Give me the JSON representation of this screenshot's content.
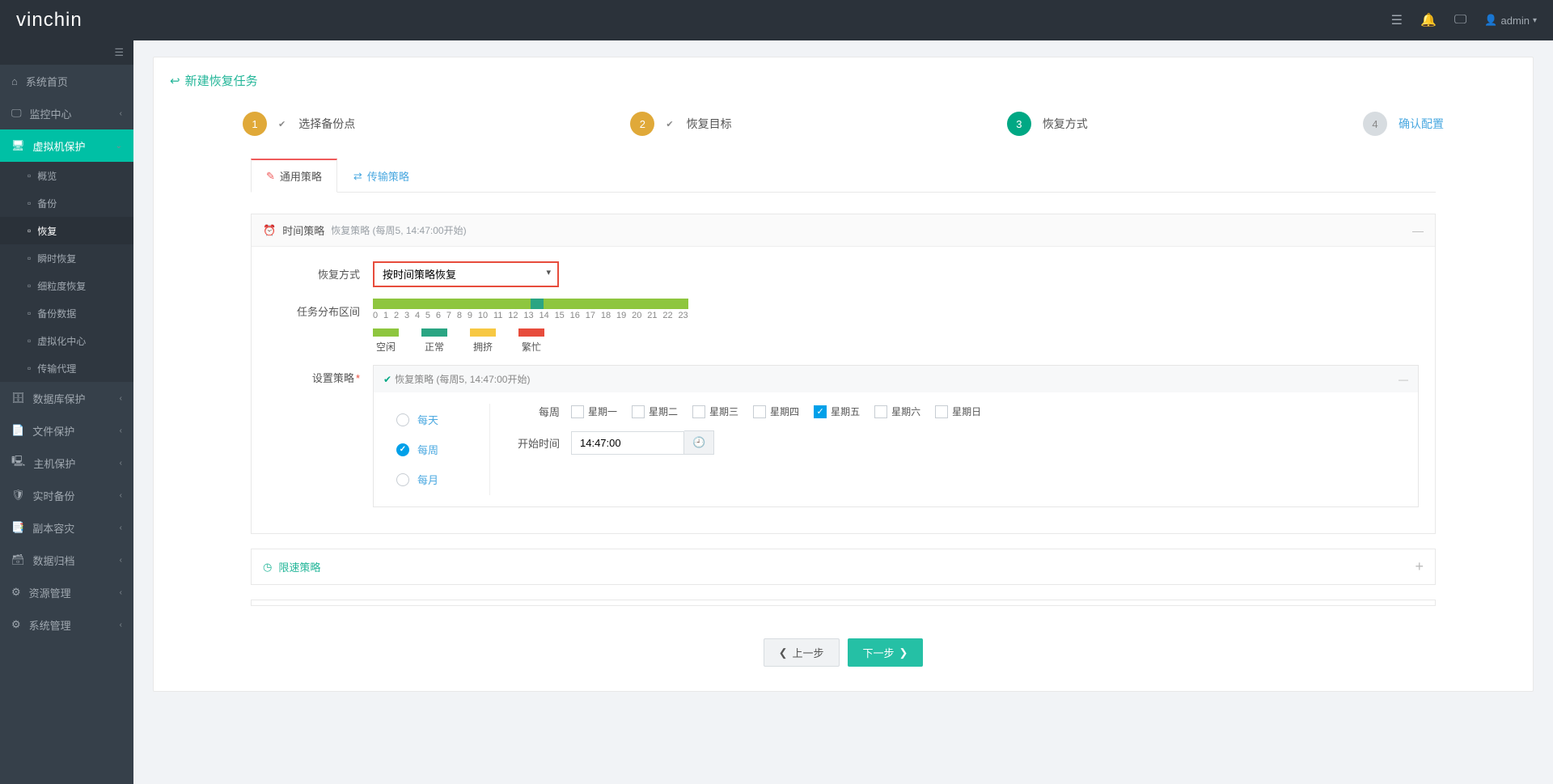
{
  "topbar": {
    "logo_a": "vin",
    "logo_b": "chin",
    "user": "admin"
  },
  "sidebar": {
    "items": [
      {
        "icon": "home",
        "label": "系统首页",
        "expand": false
      },
      {
        "icon": "monitor",
        "label": "监控中心",
        "expand": true
      },
      {
        "icon": "vm",
        "label": "虚拟机保护",
        "expand": true,
        "active": true,
        "subs": [
          {
            "label": "概览"
          },
          {
            "label": "备份"
          },
          {
            "label": "恢复",
            "sel": true
          },
          {
            "label": "瞬时恢复"
          },
          {
            "label": "细粒度恢复"
          },
          {
            "label": "备份数据"
          },
          {
            "label": "虚拟化中心"
          },
          {
            "label": "传输代理"
          }
        ]
      },
      {
        "icon": "db",
        "label": "数据库保护",
        "expand": true
      },
      {
        "icon": "file",
        "label": "文件保护",
        "expand": true
      },
      {
        "icon": "host",
        "label": "主机保护",
        "expand": true
      },
      {
        "icon": "rt",
        "label": "实时备份",
        "expand": true
      },
      {
        "icon": "copy",
        "label": "副本容灾",
        "expand": true
      },
      {
        "icon": "archive",
        "label": "数据归档",
        "expand": true
      },
      {
        "icon": "res",
        "label": "资源管理",
        "expand": true
      },
      {
        "icon": "sys",
        "label": "系统管理",
        "expand": true
      }
    ]
  },
  "page": {
    "title": "新建恢复任务",
    "steps": [
      {
        "num": "1",
        "label": "选择备份点",
        "state": "done",
        "check": true
      },
      {
        "num": "2",
        "label": "恢复目标",
        "state": "done",
        "check": true
      },
      {
        "num": "3",
        "label": "恢复方式",
        "state": "active"
      },
      {
        "num": "4",
        "label": "确认配置",
        "state": "pending"
      }
    ],
    "tabs": [
      {
        "label": "通用策略",
        "active": true
      },
      {
        "label": "传输策略"
      }
    ],
    "time_panel": {
      "title": "时间策略",
      "subtitle": "恢复策略 (每周5, 14:47:00开始)"
    },
    "restore_mode": {
      "label": "恢复方式",
      "value": "按时间策略恢复"
    },
    "dist": {
      "label": "任务分布区间",
      "hours": [
        "0",
        "1",
        "2",
        "3",
        "4",
        "5",
        "6",
        "7",
        "8",
        "9",
        "10",
        "11",
        "12",
        "13",
        "14",
        "15",
        "16",
        "17",
        "18",
        "19",
        "20",
        "21",
        "22",
        "23"
      ]
    },
    "legend": [
      {
        "c": "green",
        "t": "空闲"
      },
      {
        "c": "teal",
        "t": "正常"
      },
      {
        "c": "yellow",
        "t": "拥挤"
      },
      {
        "c": "red",
        "t": "繁忙"
      }
    ],
    "policy": {
      "label": "设置策略",
      "header": "恢复策略 (每周5, 14:47:00开始)",
      "freq": [
        {
          "label": "每天"
        },
        {
          "label": "每周",
          "on": true
        },
        {
          "label": "每月"
        }
      ],
      "weekly_label": "每周",
      "days": [
        {
          "t": "星期一"
        },
        {
          "t": "星期二"
        },
        {
          "t": "星期三"
        },
        {
          "t": "星期四"
        },
        {
          "t": "星期五",
          "on": true
        },
        {
          "t": "星期六"
        },
        {
          "t": "星期日"
        }
      ],
      "start_label": "开始时间",
      "start_value": "14:47:00"
    },
    "speed_panel": {
      "title": "限速策略"
    },
    "btn_prev": "上一步",
    "btn_next": "下一步"
  }
}
